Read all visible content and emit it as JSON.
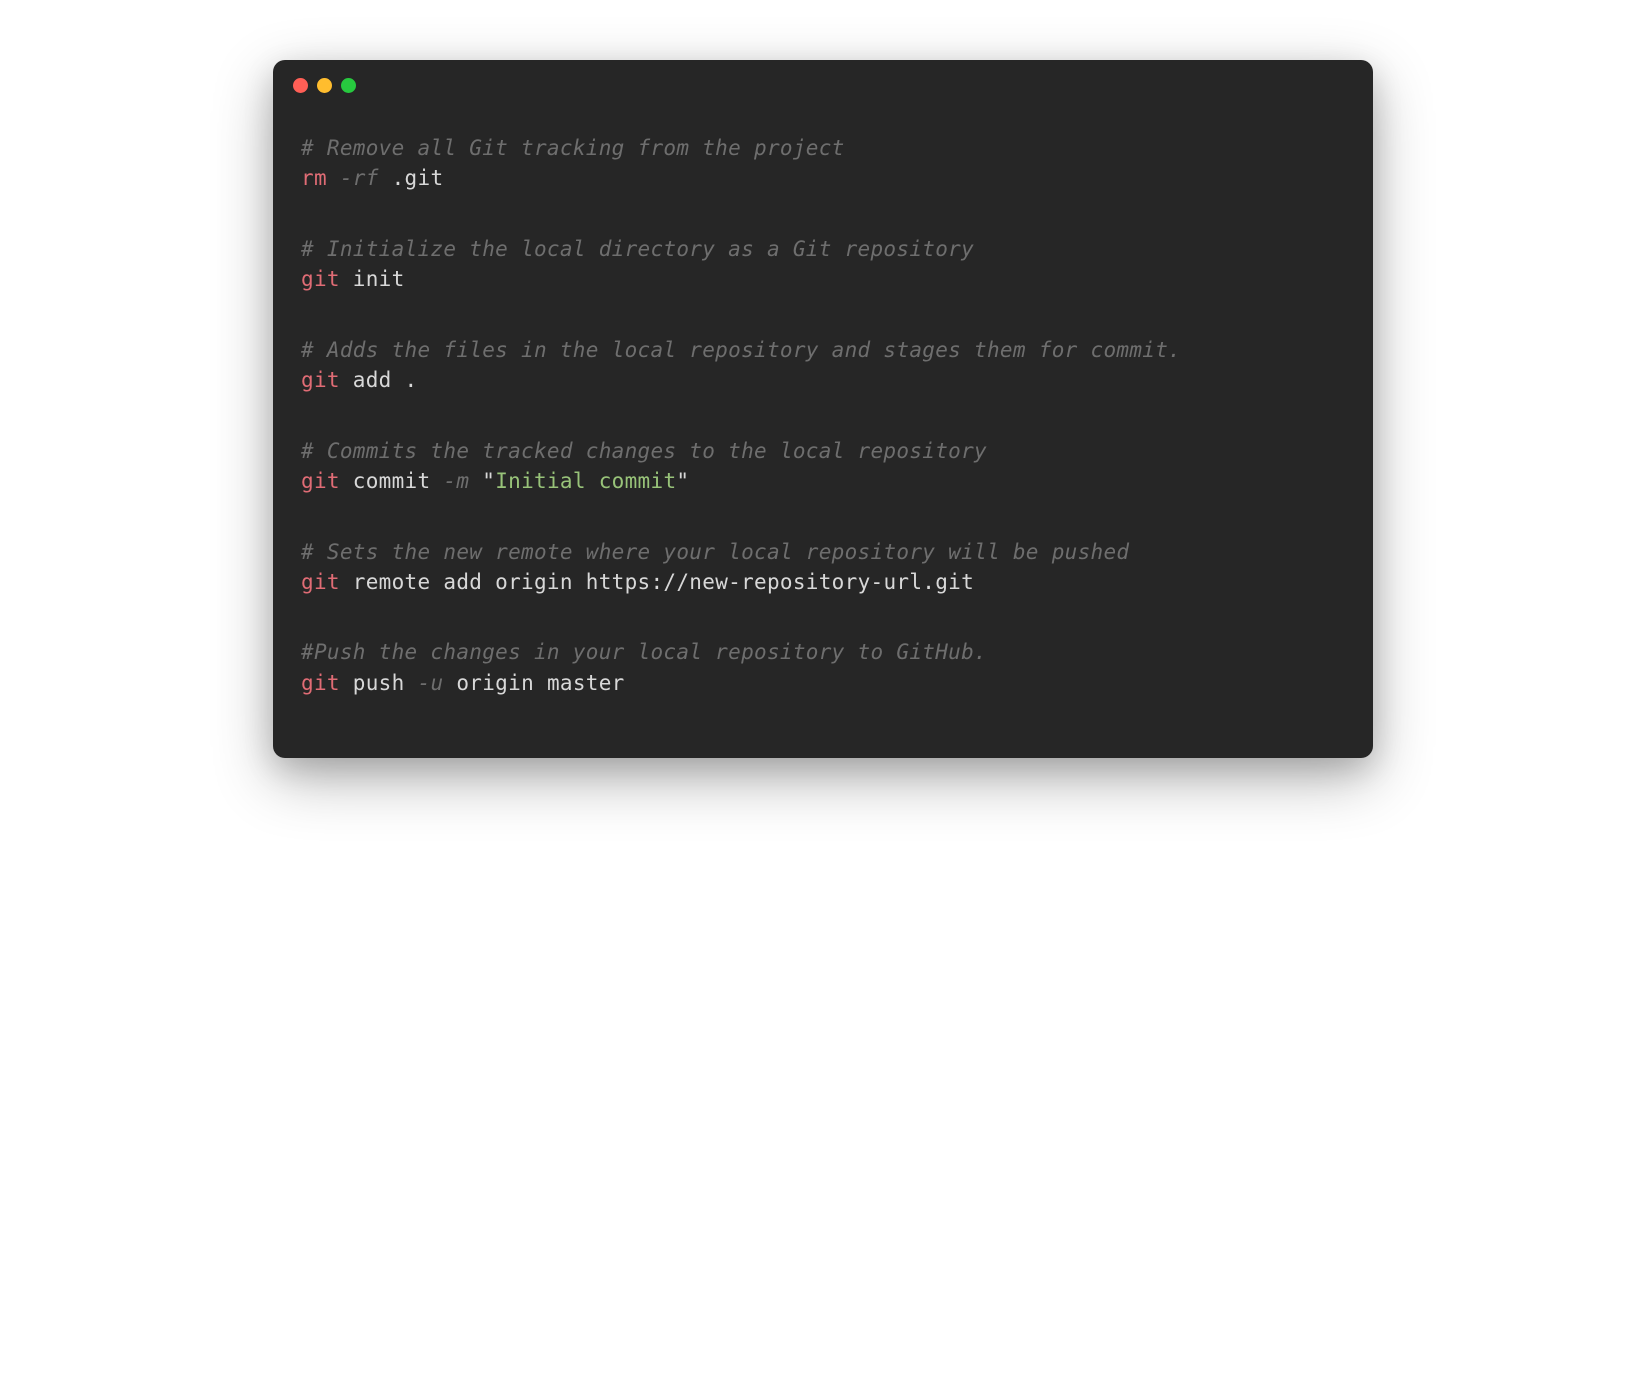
{
  "colors": {
    "background": "#262626",
    "comment": "#6e6e6e",
    "command": "#e06c75",
    "flag": "#6e6e6e",
    "plain": "#d8d8d8",
    "string": "#98c379",
    "red": "#ff5f56",
    "yellow": "#ffbd2e",
    "green": "#27c93f"
  },
  "blocks": [
    {
      "comment": "# Remove all Git tracking from the project",
      "cmd": "rm",
      "flag": " -rf",
      "rest": " .git"
    },
    {
      "comment": "# Initialize the local directory as a Git repository",
      "cmd": "git",
      "sub": " init"
    },
    {
      "comment": "# Adds the files in the local repository and stages them for commit.",
      "cmd": "git",
      "sub": " add .",
      "rest": ""
    },
    {
      "comment": "# Commits the tracked changes to the local repository",
      "cmd": "git",
      "sub": " commit",
      "flag": " -m",
      "quote1": " \"",
      "string": "Initial commit",
      "quote2": "\""
    },
    {
      "comment": "# Sets the new remote where your local repository will be pushed",
      "cmd": "git",
      "sub": " remote add origin https://new-repository-url.git"
    },
    {
      "comment": "#Push the changes in your local repository to GitHub.",
      "cmd": "git",
      "sub": " push",
      "flag": " -u",
      "rest": " origin master"
    }
  ]
}
